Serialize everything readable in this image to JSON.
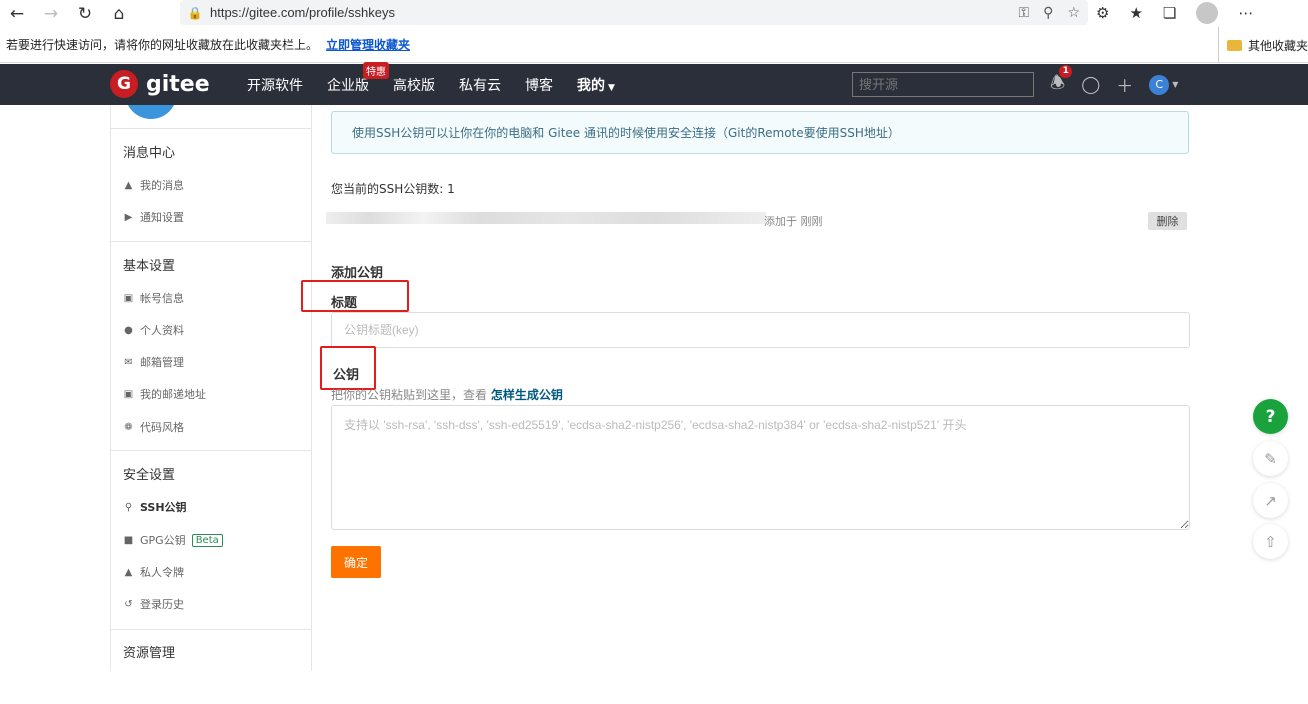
{
  "browser": {
    "url": "https://gitee.com/profile/sshkeys"
  },
  "bookmarks": {
    "message": "若要进行快速访问，请将你的网址收藏放在此收藏夹栏上。",
    "manage_link": "立即管理收藏夹",
    "other_favorites": "其他收藏夹"
  },
  "header": {
    "logo_mark": "G",
    "logo_text": "gitee",
    "nav": [
      {
        "label": "开源软件"
      },
      {
        "label": "企业版",
        "badge": "特惠"
      },
      {
        "label": "高校版"
      },
      {
        "label": "私有云"
      },
      {
        "label": "博客"
      },
      {
        "label": "我的"
      }
    ],
    "search_placeholder": "搜开源",
    "notification_count": "1",
    "avatar_letter": "C"
  },
  "sidebar": {
    "groups": [
      {
        "title": "消息中心",
        "items": [
          "我的消息",
          "通知设置"
        ]
      },
      {
        "title": "基本设置",
        "items": [
          "帐号信息",
          "个人资料",
          "邮箱管理",
          "我的邮递地址",
          "代码风格"
        ]
      },
      {
        "title": "安全设置",
        "items": [
          "SSH公钥",
          "GPG公钥",
          "私人令牌",
          "登录历史"
        ]
      },
      {
        "title": "资源管理",
        "items": []
      }
    ],
    "beta_label": "Beta"
  },
  "main": {
    "info": "使用SSH公钥可以让你在你的电脑和 Gitee 通讯的时候使用安全连接（Git的Remote要使用SSH地址）",
    "key_count": "您当前的SSH公钥数: 1",
    "key_added": "添加于 刚刚",
    "delete_label": "删除",
    "add_title": "添加公钥",
    "title_label": "标题",
    "title_placeholder": "公钥标题(key)",
    "key_label": "公钥",
    "hint": "把你的公钥粘贴到这里，查看 ",
    "hint_link": "怎样生成公钥",
    "key_placeholder": "支持以 'ssh-rsa', 'ssh-dss', 'ssh-ed25519', 'ecdsa-sha2-nistp256', 'ecdsa-sha2-nistp384' or 'ecdsa-sha2-nistp521' 开头",
    "submit_label": "确定"
  },
  "float_tools": {
    "help": "?"
  },
  "colors": {
    "header_bg": "#2b2f3a",
    "brand_red": "#c71d23",
    "submit_orange": "#fe7300",
    "annotation_red": "#e31c1c"
  }
}
